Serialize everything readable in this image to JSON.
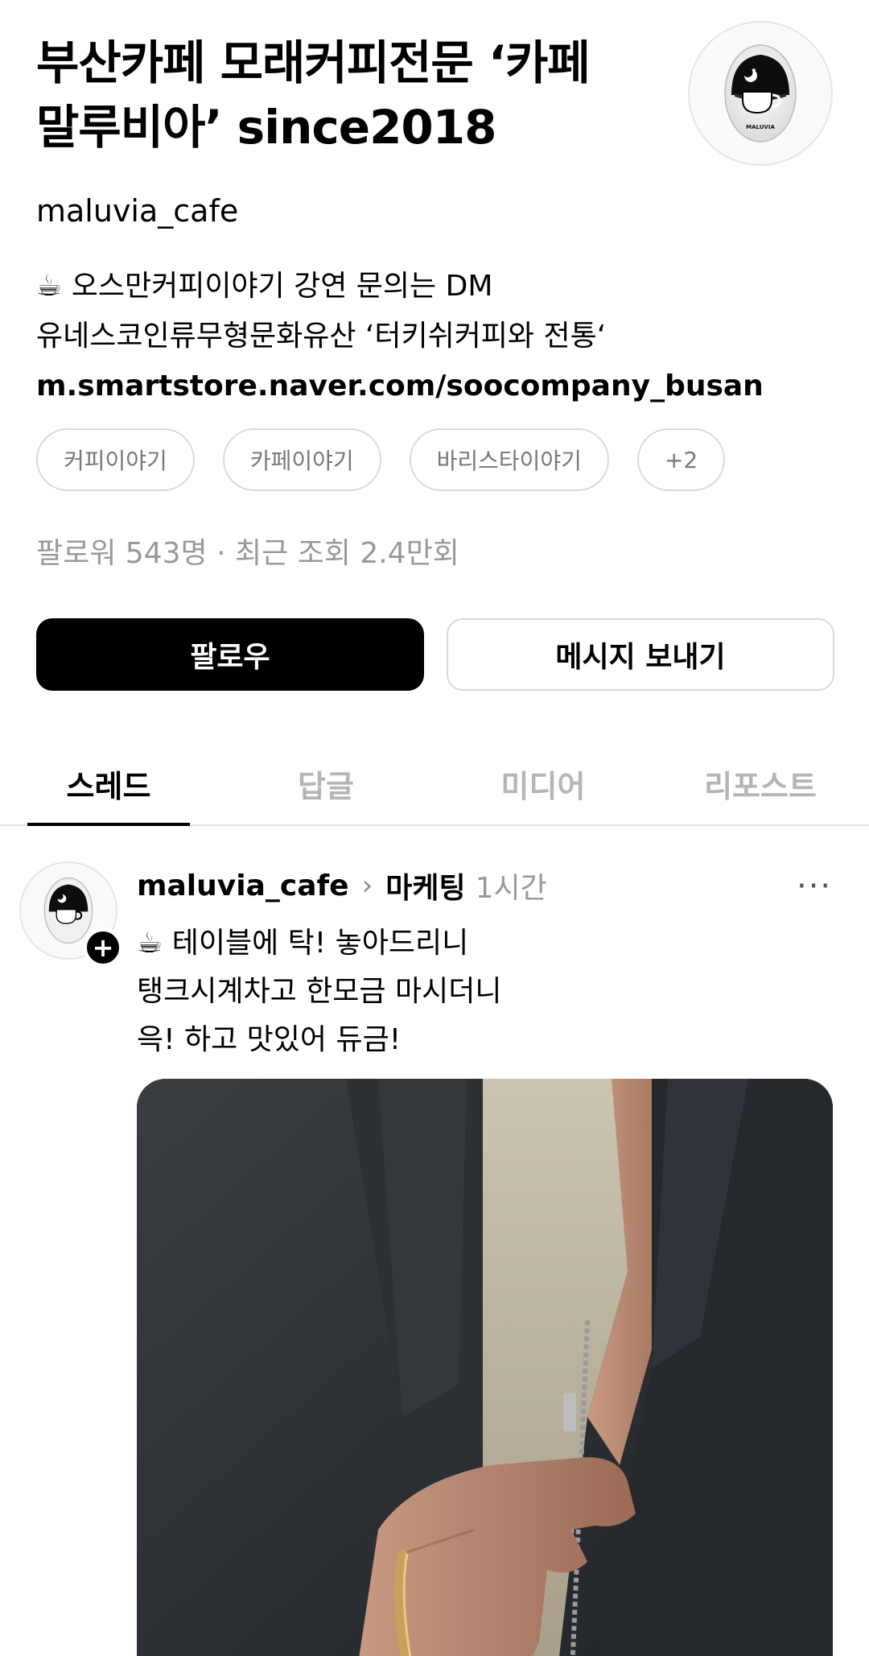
{
  "profile": {
    "title_line1": "부산카페 모래커피전문 ‘카페",
    "title_line2": "말루비아’ since2018",
    "username": "maluvia_cafe",
    "bio_line1": "☕ 오스만커피이야기 강연 문의는 DM",
    "bio_line2": "유네스코인류무형문화유산 ‘터키쉬커피와 전통‘",
    "link": "m.smartstore.naver.com/soocompany_busan",
    "tags": [
      "커피이야기",
      "카페이야기",
      "바리스타이야기",
      "+2"
    ],
    "stats": "팔로워 543명 · 최근 조회 2.4만회",
    "logo_text": "MALUVIA"
  },
  "buttons": {
    "follow": "팔로우",
    "message": "메시지 보내기"
  },
  "tabs": [
    "스레드",
    "답글",
    "미디어",
    "리포스트"
  ],
  "post": {
    "author": "maluvia_cafe",
    "chevron": "›",
    "topic": "마케팅",
    "time": "1시간",
    "more": "···",
    "add": "+",
    "line1": "☕ 테이블에 탁! 놓아드리니",
    "line2": "탱크시계차고 한모금 마시더니",
    "line3": "윽! 하고 맛있어 듀금!"
  },
  "colors": {
    "primary": "#000000",
    "muted": "#999999",
    "tab_inactive": "#b5b5b5",
    "border": "#dadada"
  },
  "icons": {
    "avatar": "cafe-logo-icon",
    "more": "more-horizontal-icon",
    "add": "plus-icon",
    "chevron": "chevron-right-icon"
  }
}
